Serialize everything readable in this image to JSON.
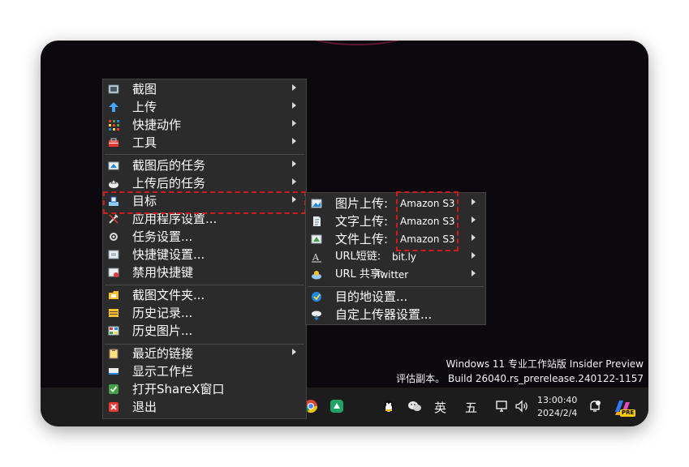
{
  "watermark": {
    "line1": "Windows 11 专业工作站版 Insider Preview",
    "line2": "评估副本。 Build 26040.rs_prerelease.240122-1157"
  },
  "taskbar": {
    "ime_lang": "英",
    "ime_mode": "五",
    "time": "13:00:40",
    "date": "2024/2/4",
    "copilot_badge": "PRE"
  },
  "main_menu": {
    "items": [
      {
        "label": "截图",
        "icon": "screenshot-icon"
      },
      {
        "label": "上传",
        "icon": "upload-arrow-icon"
      },
      {
        "label": "快捷动作",
        "icon": "grid-dots-icon"
      },
      {
        "label": "工具",
        "icon": "toolbox-icon"
      },
      {
        "label": "截图后的任务",
        "icon": "after-capture-icon"
      },
      {
        "label": "上传后的任务",
        "icon": "after-upload-icon"
      },
      {
        "label": "目标",
        "icon": "destination-icon"
      },
      {
        "label": "应用程序设置...",
        "icon": "wrench-icon"
      },
      {
        "label": "任务设置...",
        "icon": "gear-icon"
      },
      {
        "label": "快捷键设置...",
        "icon": "keyboard-icon"
      },
      {
        "label": "禁用快捷键",
        "icon": "keyboard-disabled-icon"
      },
      {
        "label": "截图文件夹...",
        "icon": "folder-icon"
      },
      {
        "label": "历史记录...",
        "icon": "history-icon"
      },
      {
        "label": "历史图片...",
        "icon": "image-history-icon"
      },
      {
        "label": "最近的链接",
        "icon": "clipboard-icon"
      },
      {
        "label": "显示工作栏",
        "icon": "taskbar-icon"
      },
      {
        "label": "打开ShareX窗口",
        "icon": "check-icon"
      },
      {
        "label": "退出",
        "icon": "close-icon"
      }
    ]
  },
  "sub_menu": {
    "items": [
      {
        "label": "图片上传:",
        "value": "Amazon S3",
        "icon": "image-upload-icon"
      },
      {
        "label": "文字上传:",
        "value": "Amazon S3",
        "icon": "text-upload-icon"
      },
      {
        "label": "文件上传:",
        "value": "Amazon S3",
        "icon": "file-upload-icon"
      },
      {
        "label": "URL短链:",
        "value": "bit.ly",
        "icon": "url-shortener-icon"
      },
      {
        "label": "URL 共享:",
        "value": "Twitter",
        "icon": "url-share-icon"
      },
      {
        "label": "目的地设置...",
        "icon": "destination-settings-icon"
      },
      {
        "label": "自定上传器设置...",
        "icon": "custom-uploader-icon"
      }
    ]
  },
  "colors": {
    "menu_bg": "#2b2b2b",
    "highlight_border": "#d11a1a",
    "desktop_bg": "#0c090e",
    "taskbar_bg": "#1c1c1c"
  }
}
